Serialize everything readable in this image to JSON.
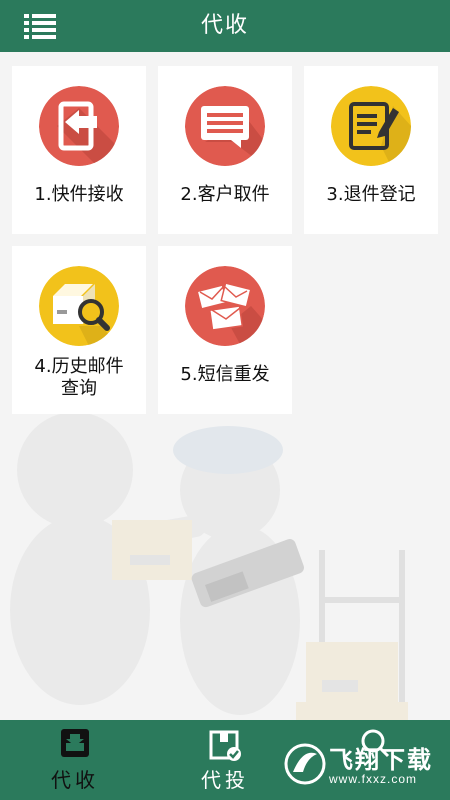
{
  "header": {
    "title": "代收",
    "menu_icon": "menu-list-icon"
  },
  "tiles": [
    {
      "label": "1.快件接收",
      "icon": "sign-in-icon",
      "color": "#e05a4f"
    },
    {
      "label": "2.客户取件",
      "icon": "message-icon",
      "color": "#e05a4f"
    },
    {
      "label": "3.退件登记",
      "icon": "edit-note-icon",
      "color": "#f2c21b"
    },
    {
      "label_line1": "4.历史邮件",
      "label_line2": "查询",
      "icon": "package-search-icon",
      "color": "#f2c21b"
    },
    {
      "label": "5.短信重发",
      "icon": "envelopes-icon",
      "color": "#e05a4f"
    }
  ],
  "tabs": [
    {
      "label": "代收",
      "icon": "inbox-icon",
      "active": true
    },
    {
      "label": "代投",
      "icon": "box-check-icon",
      "active": false
    },
    {
      "label": "",
      "icon": "search-icon",
      "active": false
    }
  ],
  "watermark": {
    "text": "飞翔下载",
    "url": "www.fxxz.com"
  },
  "colors": {
    "primary": "#2b7a5c",
    "red": "#e05a4f",
    "yellow": "#f2c21b"
  }
}
